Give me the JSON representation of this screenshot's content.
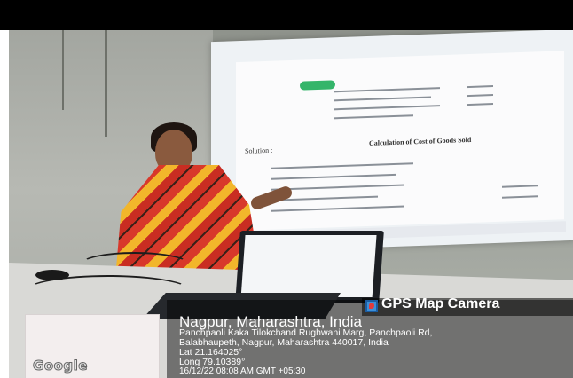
{
  "overlay": {
    "app_name": "GPS Map Camera",
    "city": "Nagpur, Maharashtra, India",
    "address_line_1": "Panchpaoli Kaka Tilokchand Rughwani Marg, Panchpaoli Rd,",
    "address_line_2": "Balabhaupeth, Nagpur, Maharashtra 440017, India",
    "latitude": "Lat 21.164025°",
    "longitude": "Long 79.10389°",
    "datetime": "16/12/22 08:08 AM GMT +05:30"
  },
  "map_thumbnail": {
    "provider_label": "Google"
  },
  "slide": {
    "heading": "Calculation of Cost of Goods Sold",
    "solution_label": "Solution :"
  },
  "colors": {
    "overlay_bg": "rgba(0,0,0,0.48)",
    "text": "#ffffff",
    "logo_blue": "#3b8fd8"
  }
}
